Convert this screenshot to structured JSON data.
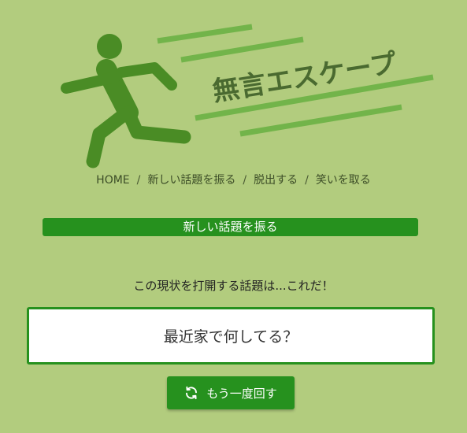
{
  "logo": {
    "title": "無言エスケープ"
  },
  "breadcrumb": {
    "items": [
      "HOME",
      "新しい話題を振る",
      "脱出する",
      "笑いを取る"
    ],
    "separator": "/"
  },
  "section": {
    "title": "新しい話題を振る"
  },
  "intro_text": "この現状を打開する話題は...これだ！",
  "result": {
    "topic": "最近家で何してる？"
  },
  "spin_button": {
    "label": "もう一度回す",
    "icon": "refresh-icon"
  },
  "colors": {
    "background": "#b2cc7e",
    "accent_green": "#26911e",
    "logo_green": "#4a8c25",
    "stripe_green": "#72b44a"
  }
}
